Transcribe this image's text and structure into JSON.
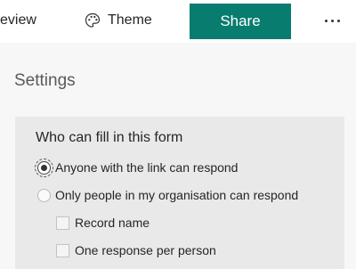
{
  "topbar": {
    "review_label": "eview",
    "theme_label": "Theme",
    "share_label": "Share",
    "more_icon": "more-horizontal-icon",
    "theme_icon": "palette-icon",
    "accent_color": "#087c6e"
  },
  "settings": {
    "title": "Settings",
    "who_can_fill": {
      "heading": "Who can fill in this form",
      "options": [
        {
          "label": "Anyone with the link can respond",
          "selected": true
        },
        {
          "label": "Only people in my organisation can respond",
          "selected": false
        }
      ],
      "sub_options": [
        {
          "label": "Record name",
          "checked": false
        },
        {
          "label": "One response per person",
          "checked": false
        }
      ]
    }
  }
}
